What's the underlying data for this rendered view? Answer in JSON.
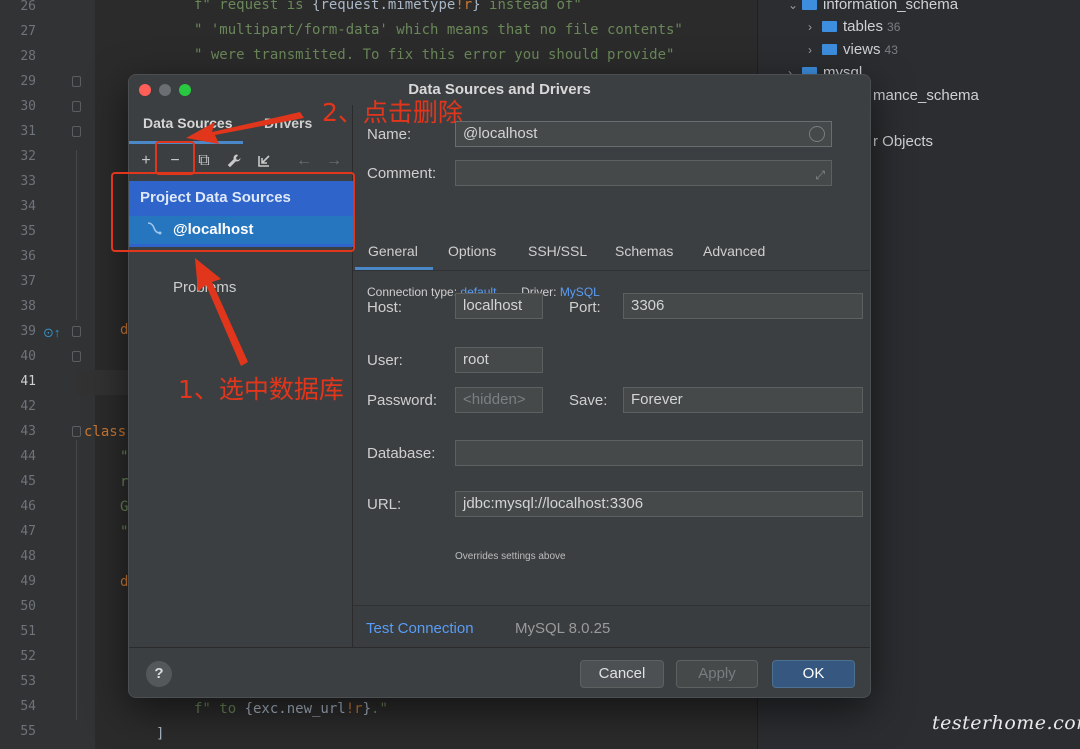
{
  "editor": {
    "line_numbers": [
      "26",
      "27",
      "28",
      "29",
      "30",
      "31",
      "32",
      "33",
      "34",
      "35",
      "36",
      "37",
      "38",
      "39",
      "40",
      "41",
      "42",
      "43",
      "44",
      "45",
      "46",
      "47",
      "48",
      "49",
      "50",
      "51",
      "52",
      "53",
      "54",
      "55"
    ],
    "active_line": "41",
    "code_lines": {
      "l26_a": "f\" request is ",
      "l26_b": "{request.mimetype",
      "l26_c": "!r",
      "l26_d": "}",
      "l26_e": " instead of\"",
      "l27": "\" 'multipart/form-data' which means that no file contents\"",
      "l28": "\" were transmitted. To fix this error you should provide\"",
      "l39": "d",
      "l43": "class",
      "l44": "\"",
      "l45": "r",
      "l46": "G",
      "l47": "\"",
      "l49": "d",
      "l54_a": "f\" to ",
      "l54_b": "{exc.new_url",
      "l54_c": "!r",
      "l54_d": "}",
      "l54_e": ".\"",
      "l55": "]"
    }
  },
  "tree": {
    "rows": [
      {
        "label": "information_schema",
        "count": ""
      },
      {
        "label": "tables",
        "count": "36"
      },
      {
        "label": "views",
        "count": "43"
      },
      {
        "label": "mysql",
        "count": ""
      },
      {
        "label": "mance_schema",
        "count": ""
      },
      {
        "label": "r Objects",
        "count": ""
      }
    ]
  },
  "dialog": {
    "title": "Data Sources and Drivers",
    "left_tabs": {
      "data_sources": "Data Sources",
      "drivers": "Drivers"
    },
    "toolbar": {
      "add": "+",
      "remove": "−",
      "duplicate": "⧉",
      "settings": "🔧",
      "import": "⇲",
      "back": "←",
      "forward": "→"
    },
    "section_header": "Project Data Sources",
    "selected_source": "@localhost",
    "problems": "Problems",
    "form": {
      "name_label": "Name:",
      "name_value": "@localhost",
      "comment_label": "Comment:",
      "comment_value": "",
      "tabs": [
        "General",
        "Options",
        "SSH/SSL",
        "Schemas",
        "Advanced"
      ],
      "connection_type_label": "Connection type:",
      "connection_type_value": "default",
      "driver_label": "Driver:",
      "driver_value": "MySQL",
      "host_label": "Host:",
      "host_value": "localhost",
      "port_label": "Port:",
      "port_value": "3306",
      "user_label": "User:",
      "user_value": "root",
      "password_label": "Password:",
      "password_value": "<hidden>",
      "save_label": "Save:",
      "save_value": "Forever",
      "database_label": "Database:",
      "database_value": "",
      "url_label": "URL:",
      "url_value": "jdbc:mysql://localhost:3306",
      "url_hint": "Overrides settings above"
    },
    "test_connection": "Test Connection",
    "server_version": "MySQL 8.0.25",
    "buttons": {
      "help": "?",
      "cancel": "Cancel",
      "apply": "Apply",
      "ok": "OK"
    }
  },
  "annotations": {
    "step1": "1、选中数据库",
    "step2": "2、点击删除",
    "color": "#e2361c"
  },
  "watermark": "testerhome.com"
}
